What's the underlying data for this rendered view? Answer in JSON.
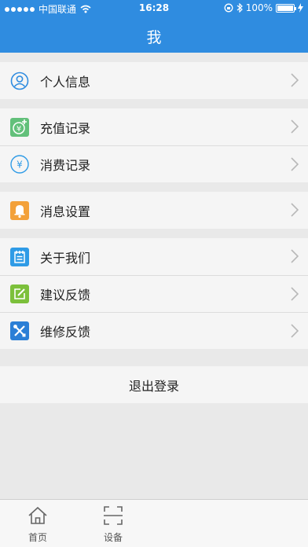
{
  "status_bar": {
    "carrier": "中国联通",
    "time": "16:28",
    "battery": "100%"
  },
  "nav": {
    "title": "我"
  },
  "menu": [
    {
      "items": [
        {
          "label": "个人信息",
          "icon": "user-circle-icon"
        }
      ]
    },
    {
      "items": [
        {
          "label": "充值记录",
          "icon": "recharge-icon"
        },
        {
          "label": "消费记录",
          "icon": "yen-circle-icon"
        }
      ]
    },
    {
      "items": [
        {
          "label": "消息设置",
          "icon": "bell-icon"
        }
      ]
    },
    {
      "items": [
        {
          "label": "关于我们",
          "icon": "notepad-icon"
        },
        {
          "label": "建议反馈",
          "icon": "edit-icon"
        },
        {
          "label": "维修反馈",
          "icon": "tools-icon"
        }
      ]
    }
  ],
  "logout_label": "退出登录",
  "tabbar": [
    {
      "label": "首页",
      "icon": "home-icon"
    },
    {
      "label": "设备",
      "icon": "scan-icon"
    }
  ],
  "colors": {
    "nav_bg": "#2f8ce0",
    "recharge_green": "#62c07a",
    "bell_orange": "#f3a13a",
    "notepad_blue": "#2f9be6",
    "edit_green": "#7cc03b",
    "tools_blue": "#2b7fd6"
  }
}
